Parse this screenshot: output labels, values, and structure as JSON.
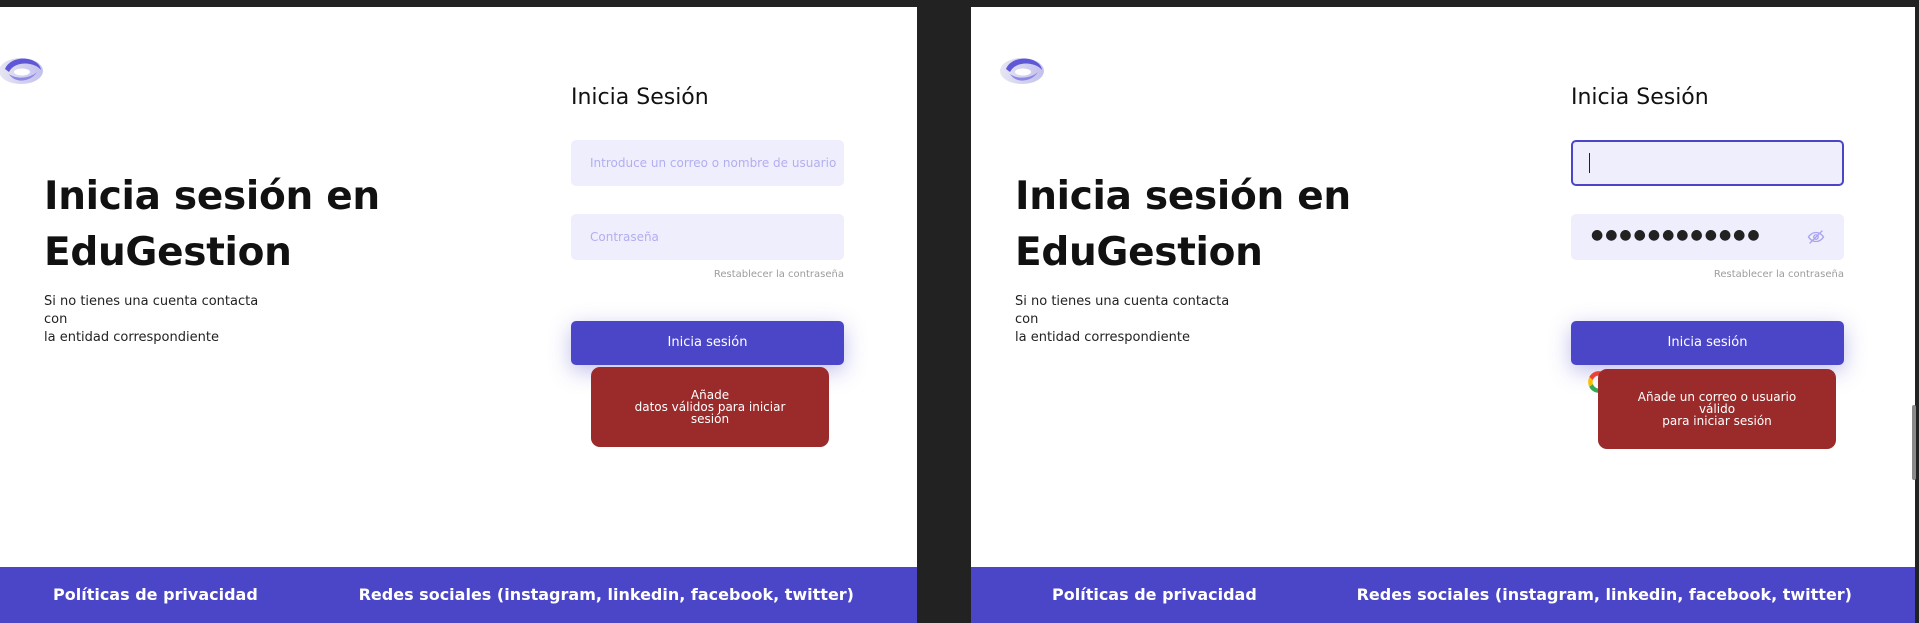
{
  "screens": {
    "left": {
      "hero": {
        "title_line1": "Inicia sesión en",
        "title_line2": "EduGestion",
        "sub_line1": "Si no tienes una cuenta contacta con",
        "sub_line2": "la entidad correspondiente"
      },
      "form": {
        "title": "Inicia Sesión",
        "user_placeholder": "Introduce un correo o nombre de usuario",
        "password_placeholder": "Contraseña",
        "reset_link": "Restablecer la contraseña",
        "submit_label": "Inicia sesión"
      },
      "error": {
        "line1": "Añade",
        "line2": "datos válidos para iniciar",
        "line3": "sesión"
      },
      "footer": {
        "privacy": "Políticas de privacidad",
        "social": "Redes sociales (instagram, linkedin, facebook, twitter)"
      }
    },
    "right": {
      "hero": {
        "title_line1": "Inicia sesión en",
        "title_line2": "EduGestion",
        "sub_line1": "Si no tienes una cuenta contacta con",
        "sub_line2": "la entidad correspondiente"
      },
      "form": {
        "title": "Inicia Sesión",
        "user_value": "",
        "password_value": "●●●●●●●●●●●●",
        "reset_link": "Restablecer la contraseña",
        "submit_label": "Inicia sesión"
      },
      "error": {
        "line1": "Añade un correo o usuario válido",
        "line2": "para iniciar sesión"
      },
      "footer": {
        "privacy": "Políticas de privacidad",
        "social": "Redes sociales (instagram, linkedin, facebook, twitter)"
      }
    }
  },
  "icons": {
    "logo": "edugestion-logo-icon",
    "google": "google-icon",
    "visibility": "eye-off-icon"
  },
  "colors": {
    "accent": "#4b46c7",
    "field_bg": "#efeefd",
    "error": "#9b2a2a",
    "background": "#222222"
  }
}
